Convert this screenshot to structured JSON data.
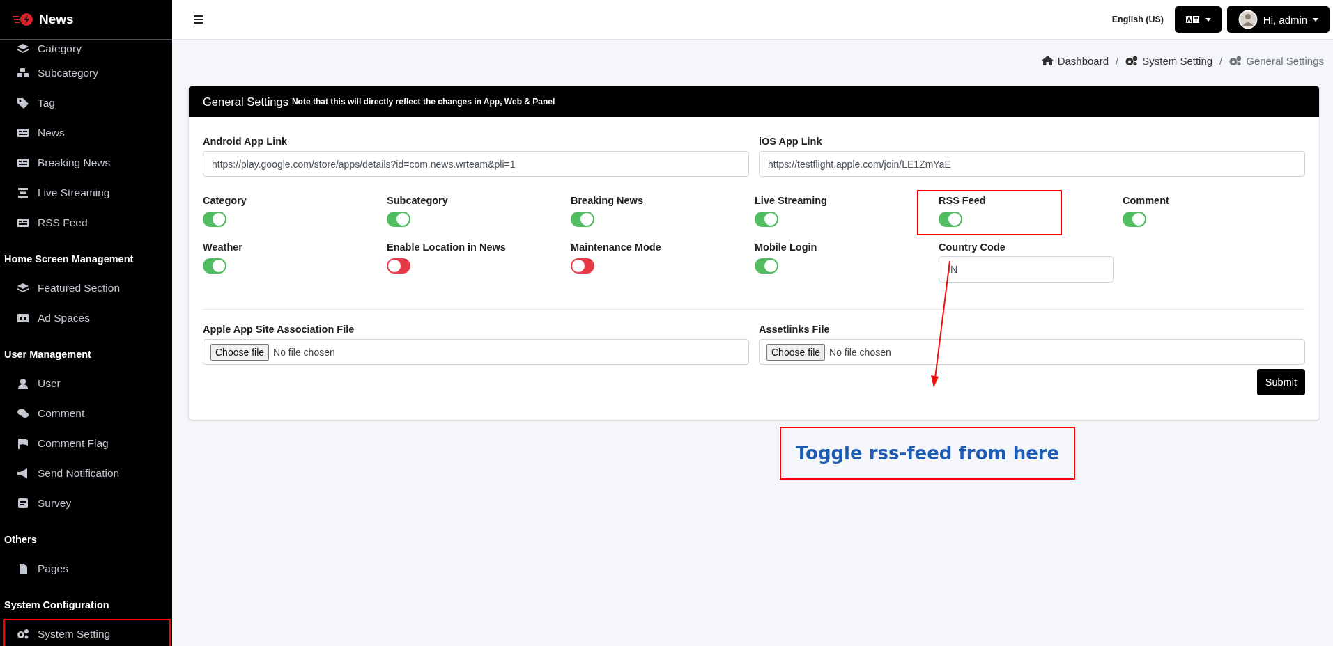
{
  "sidebar": {
    "brand": "News",
    "sections": [
      {
        "items": [
          {
            "label": "Category",
            "outlined": false
          },
          {
            "label": "Subcategory",
            "outlined": false
          },
          {
            "label": "Tag",
            "outlined": false
          },
          {
            "label": "News",
            "outlined": false
          },
          {
            "label": "Breaking News",
            "outlined": false
          },
          {
            "label": "Live Streaming",
            "outlined": false
          },
          {
            "label": "RSS Feed",
            "outlined": false
          }
        ]
      },
      {
        "heading": "Home Screen Management",
        "items": [
          {
            "label": "Featured Section",
            "outlined": false
          },
          {
            "label": "Ad Spaces",
            "outlined": false
          }
        ]
      },
      {
        "heading": "User Management",
        "items": [
          {
            "label": "User",
            "outlined": false
          },
          {
            "label": "Comment",
            "outlined": false
          },
          {
            "label": "Comment Flag",
            "outlined": false
          },
          {
            "label": "Send Notification",
            "outlined": false
          },
          {
            "label": "Survey",
            "outlined": false
          }
        ]
      },
      {
        "heading": "Others",
        "items": [
          {
            "label": "Pages",
            "outlined": false
          }
        ]
      },
      {
        "heading": "System Configuration",
        "items": [
          {
            "label": "System Setting",
            "outlined": true
          }
        ]
      }
    ]
  },
  "header": {
    "language": "English (US)",
    "user": "Hi, admin"
  },
  "breadcrumb": [
    {
      "label": "Dashboard",
      "current": false
    },
    {
      "separator": "/",
      "label": "System Setting",
      "current": false
    },
    {
      "separator": "/",
      "label": "General Settings",
      "current": true
    }
  ],
  "card": {
    "title": "General Settings",
    "note": "Note that this will directly reflect the changes in App, Web & Panel",
    "links": [
      {
        "label": "Android App Link",
        "value": "https://play.google.com/store/apps/details?id=com.news.wrteam&pli=1"
      },
      {
        "label": "iOS App Link",
        "value": "https://testflight.apple.com/join/LE1ZmYaE"
      }
    ],
    "settings": [
      {
        "kind": "toggle",
        "label": "Category",
        "on": true,
        "outlined": false
      },
      {
        "kind": "toggle",
        "label": "Subcategory",
        "on": true,
        "outlined": false
      },
      {
        "kind": "toggle",
        "label": "Breaking News",
        "on": true,
        "outlined": false
      },
      {
        "kind": "toggle",
        "label": "Live Streaming",
        "on": true,
        "outlined": false
      },
      {
        "kind": "toggle",
        "label": "RSS Feed",
        "on": true,
        "outlined": true
      },
      {
        "kind": "toggle",
        "label": "Comment",
        "on": true,
        "outlined": false
      },
      {
        "kind": "toggle",
        "label": "Weather",
        "on": true,
        "outlined": false
      },
      {
        "kind": "toggle",
        "label": "Enable Location in News",
        "on": false,
        "outlined": false
      },
      {
        "kind": "toggle",
        "label": "Maintenance Mode",
        "on": false,
        "outlined": false
      },
      {
        "kind": "toggle",
        "label": "Mobile Login",
        "on": true,
        "outlined": false
      },
      {
        "kind": "text",
        "label": "Country Code",
        "value": "IN",
        "outlined": false
      }
    ],
    "files": [
      {
        "label": "Apple App Site Association File",
        "button": "Choose file",
        "status": "No file chosen"
      },
      {
        "label": "Assetlinks File",
        "button": "Choose file",
        "status": "No file chosen"
      }
    ],
    "submit": "Submit"
  },
  "annotation": {
    "text": "Toggle rss-feed from here"
  }
}
